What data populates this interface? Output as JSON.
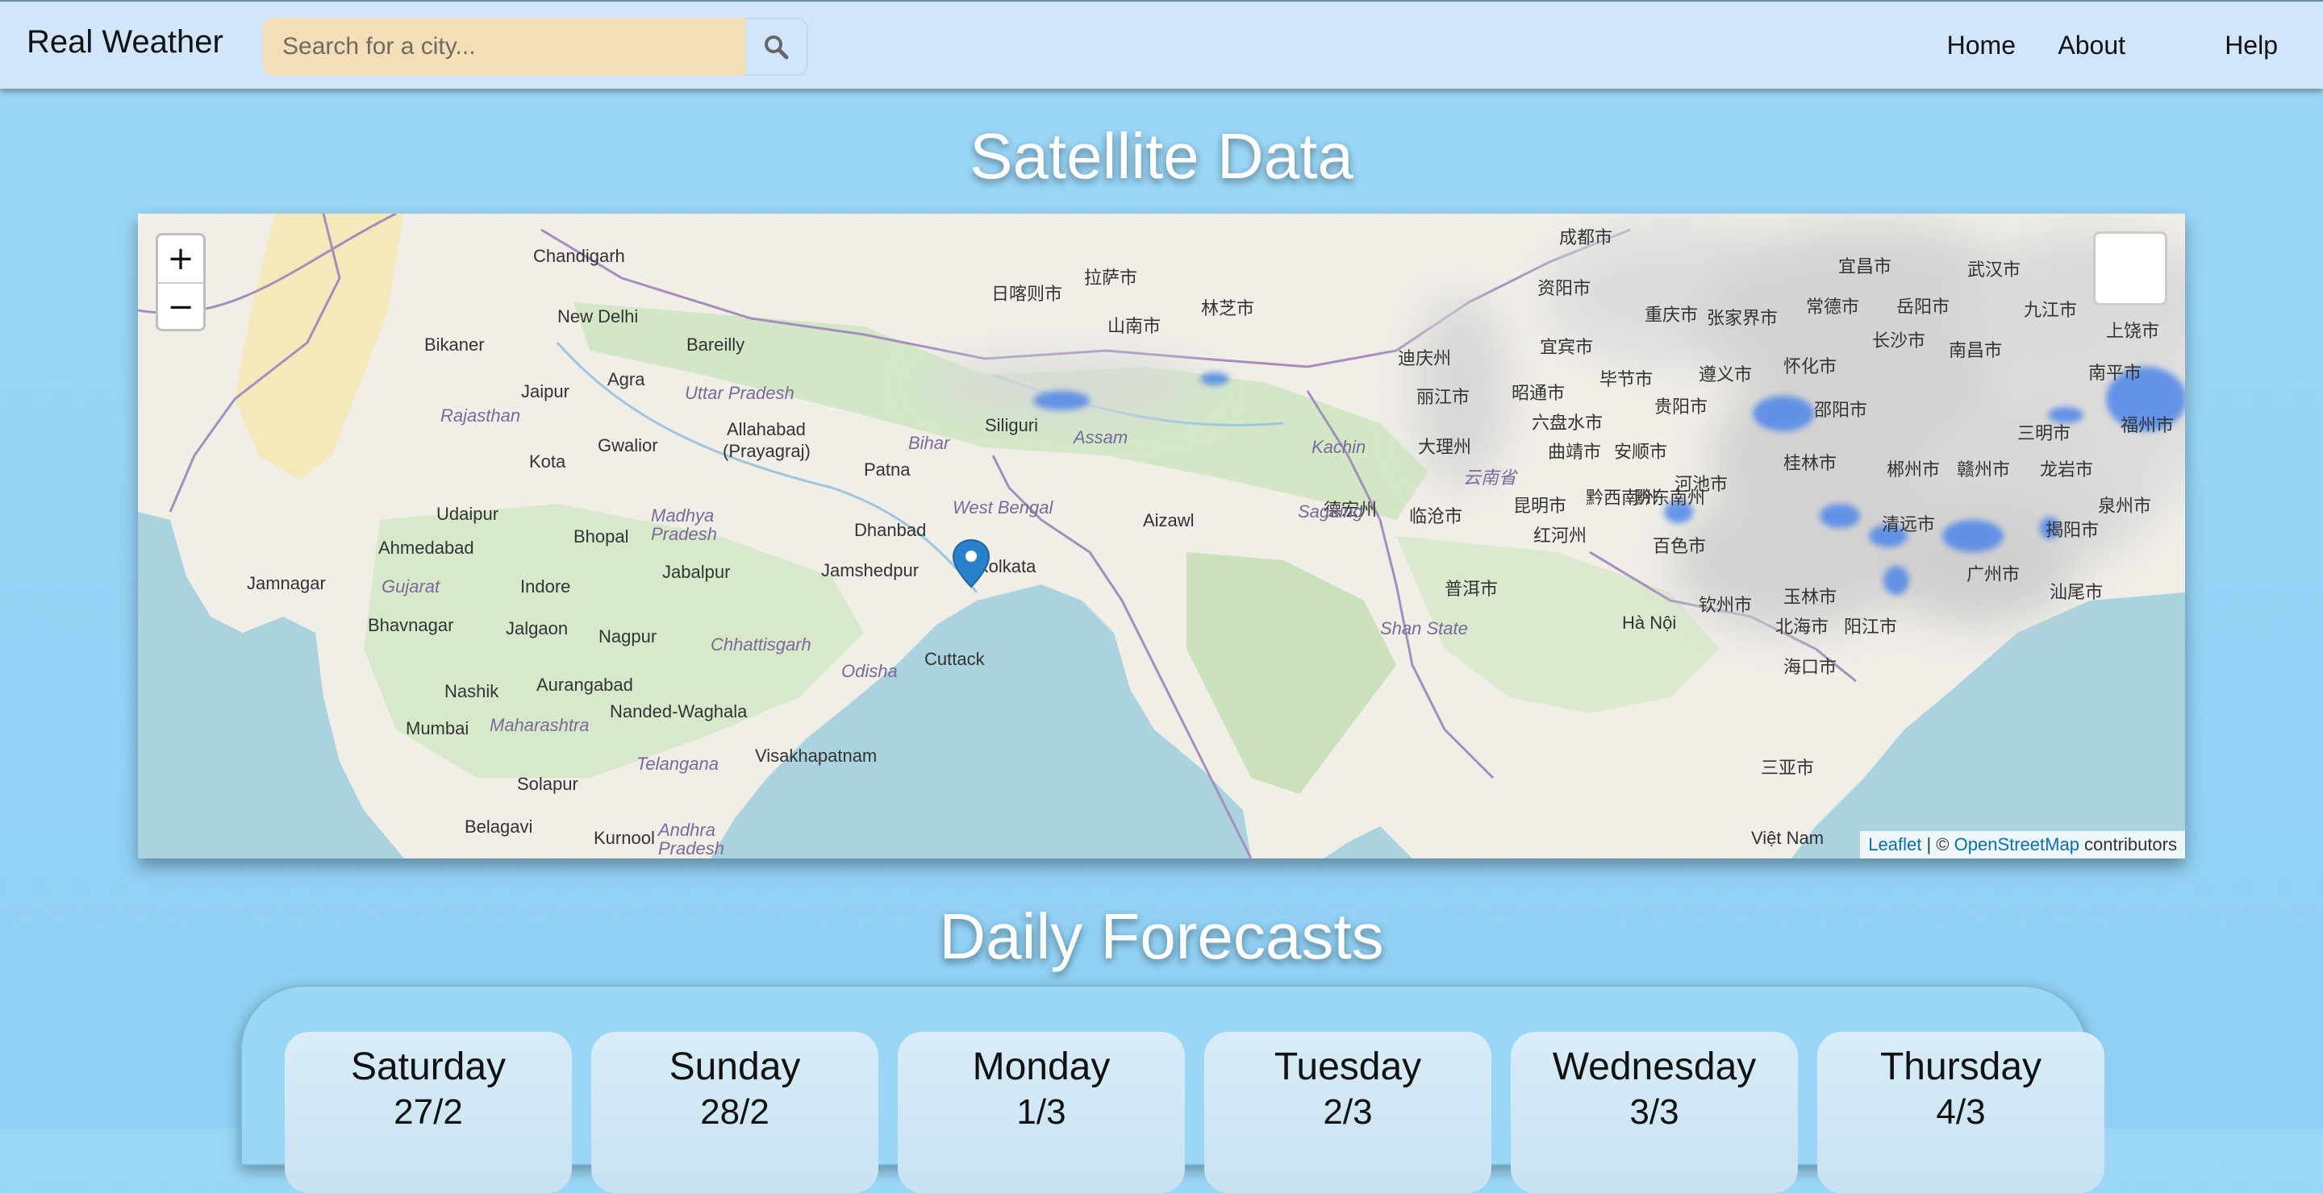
{
  "navbar": {
    "brand": "Real Weather",
    "search_placeholder": "Search for a city...",
    "links": [
      "Home",
      "About",
      "Help"
    ]
  },
  "satellite": {
    "title": "Satellite Data",
    "attribution": {
      "leaflet": "Leaflet",
      "separator": " | © ",
      "osm": "OpenStreetMap",
      "suffix": " contributors"
    },
    "zoom_in": "+",
    "zoom_out": "−",
    "labels": [
      "Chandigarh",
      "New Delhi",
      "Bikaner",
      "Jaipur",
      "Agra",
      "Bareilly",
      "Uttar Pradesh",
      "Rajasthan",
      "Kota",
      "Gwalior",
      "Allahabad",
      "(Prayagraj)",
      "Patna",
      "Bihar",
      "Siliguri",
      "Assam",
      "Udaipur",
      "Bhopal",
      "Madhya",
      "Pradesh",
      "Dhanbad",
      "West Bengal",
      "Ahmedabad",
      "Jabalpur",
      "Jamshedpur",
      "Kolkata",
      "Jamnagar",
      "Gujarat",
      "Indore",
      "Bhavnagar",
      "Jalgaon",
      "Nagpur",
      "Chhattisgarh",
      "Cuttack",
      "Odisha",
      "Nashik",
      "Aurangabad",
      "Maharashtra",
      "Nanded-Waghala",
      "Mumbai",
      "Telangana",
      "Visakhapatnam",
      "Solapur",
      "Belagavi",
      "Kurnool",
      "Andhra",
      "Pradesh",
      "Aizawl",
      "Việt Nam",
      "Hà Nội",
      "日喀则市",
      "拉萨市",
      "山南市",
      "林芝市",
      "成都市",
      "资阳市",
      "重庆市",
      "宜宾市",
      "毕节市",
      "遵义市",
      "怀化市",
      "长沙市",
      "南昌市",
      "武汉市",
      "九江市",
      "宜昌市",
      "张家界市",
      "常德市",
      "岳阳市",
      "上饶市",
      "南平市",
      "福州市",
      "邵阳市",
      "贵阳市",
      "黔东南州",
      "桂林市",
      "郴州市",
      "赣州市",
      "三明市",
      "龙岩市",
      "泉州市",
      "丽江市",
      "昭通市",
      "六盘水市",
      "曲靖市",
      "安顺市",
      "大理州",
      "云南省",
      "昆明市",
      "红河州",
      "黔西南州",
      "河池市",
      "百色市",
      "清远市",
      "揭阳市",
      "汕尾市",
      "广州市",
      "玉林市",
      "钦州市",
      "北海市",
      "阳江市",
      "海口市",
      "三亚市",
      "迪庆州",
      "德宏州",
      "临沧市",
      "普洱市",
      "Kachin",
      "Sagaing",
      "Shan State"
    ]
  },
  "forecast": {
    "title": "Daily Forecasts",
    "days": [
      {
        "name": "Saturday",
        "date": "27/2"
      },
      {
        "name": "Sunday",
        "date": "28/2"
      },
      {
        "name": "Monday",
        "date": "1/3"
      },
      {
        "name": "Tuesday",
        "date": "2/3"
      },
      {
        "name": "Wednesday",
        "date": "3/3"
      },
      {
        "name": "Thursday",
        "date": "4/3"
      }
    ]
  },
  "colors": {
    "background": "#9cd7f7",
    "navbar": "#d2e6fb",
    "search_field": "#f4deb8",
    "marker": "#2a81cb",
    "precipitation": "#4f86e8"
  }
}
